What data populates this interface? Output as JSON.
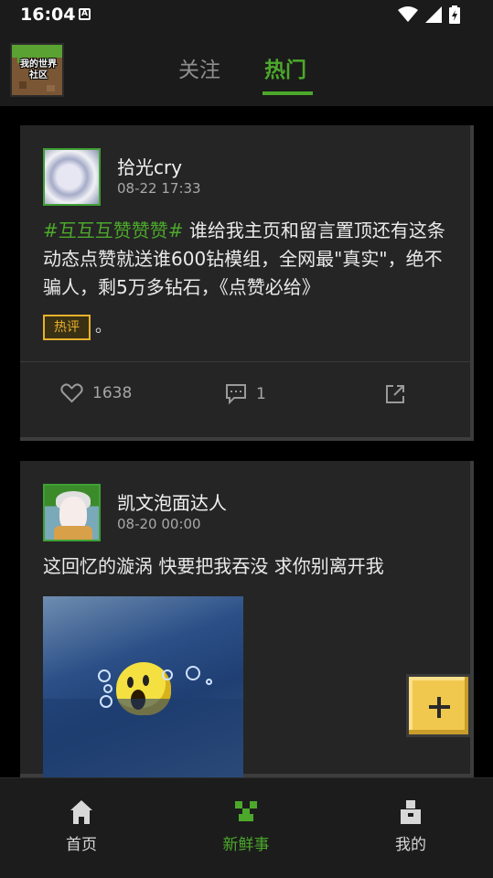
{
  "status_bar": {
    "time": "16:04",
    "notification_badge": "A"
  },
  "header": {
    "logo_text": "我的世界社区",
    "tabs": [
      {
        "label": "关注",
        "active": false
      },
      {
        "label": "热门",
        "active": true
      }
    ]
  },
  "posts": [
    {
      "username": "拾光cry",
      "timestamp": "08-22 17:33",
      "hashtag": "#互互互赞赞赞#",
      "text": " 谁给我主页和留言置顶还有这条动态点赞就送谁600钻模组，全网最\"真实\"，绝不骗人，剩5万多钻石，《点赞必给》",
      "badge": "热评",
      "badge_suffix": "。",
      "likes": "1638",
      "comments": "1"
    },
    {
      "username": "凯文泡面达人",
      "timestamp": "08-20 00:00",
      "text": "这回忆的漩涡 快要把我吞没 求你别离开我"
    }
  ],
  "bottom_nav": [
    {
      "label": "首页",
      "icon": "home-icon",
      "active": false
    },
    {
      "label": "新鲜事",
      "icon": "creeper-icon",
      "active": true
    },
    {
      "label": "我的",
      "icon": "profile-icon",
      "active": false
    }
  ],
  "colors": {
    "accent": "#4ca82b",
    "badge": "#e6b12d",
    "fab": "#f1c84e",
    "card": "#252525"
  }
}
